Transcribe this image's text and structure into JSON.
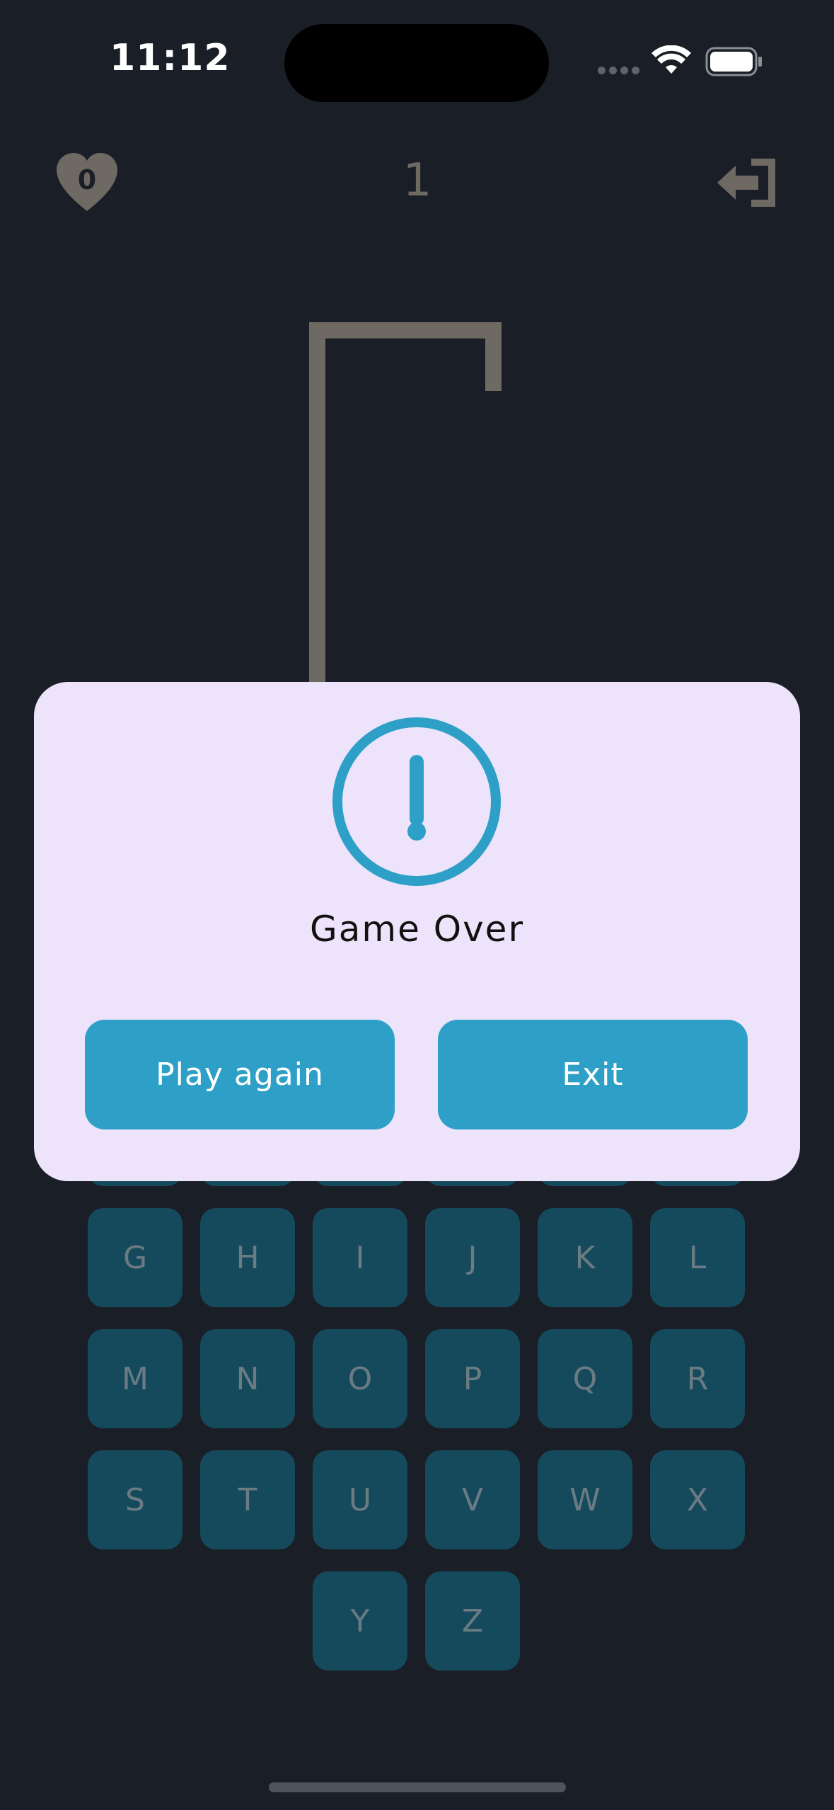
{
  "status_bar": {
    "time": "11:12"
  },
  "header": {
    "lives": "0",
    "level": "1",
    "lives_icon": "heart-icon",
    "exit_icon": "exit-door-icon"
  },
  "keyboard": {
    "rows": [
      [
        "G",
        "H",
        "I",
        "J",
        "K",
        "L"
      ],
      [
        "M",
        "N",
        "O",
        "P",
        "Q",
        "R"
      ],
      [
        "S",
        "T",
        "U",
        "V",
        "W",
        "X"
      ],
      [
        "Y",
        "Z"
      ]
    ]
  },
  "modal": {
    "icon": "exclamation-circle-icon",
    "title": "Game Over",
    "play_again_label": "Play again",
    "exit_label": "Exit"
  },
  "colors": {
    "background": "#1a1f27",
    "accent": "#2ea0c7",
    "modal_bg": "#ede3fb",
    "key_bg": "#154a5c",
    "muted": "#6e6a63"
  }
}
